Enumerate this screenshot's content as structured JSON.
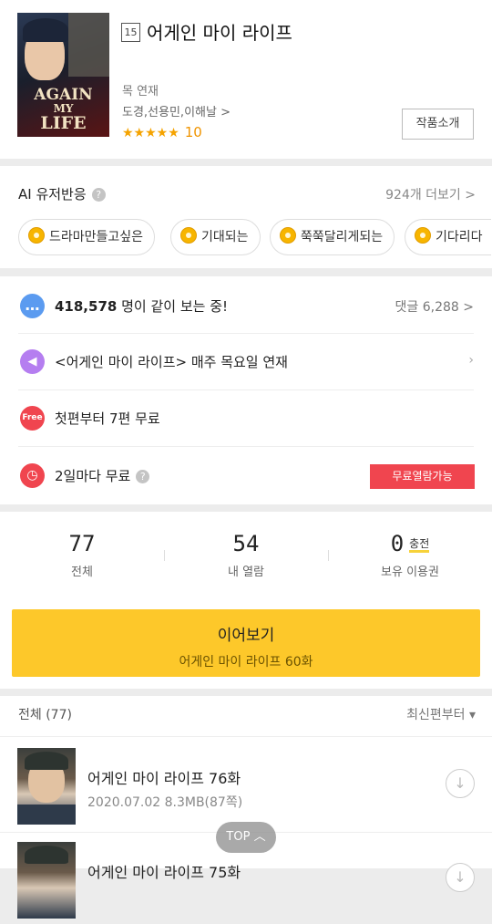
{
  "header": {
    "age_rating": "15",
    "title": "어게인 마이 라이프",
    "schedule": "목 연재",
    "authors": "도경,선용민,이해날 >",
    "stars": "★★★★★",
    "rating": "10",
    "intro_button": "작품소개",
    "cover_text_1": "AGAIN",
    "cover_text_2": "MY",
    "cover_text_3": "LIFE"
  },
  "ai": {
    "title": "AI 유저반응",
    "more": "924개 더보기 >",
    "chips": [
      "드라마만들고싶은",
      "기대되는",
      "쭉쭉달리게되는",
      "기다리다"
    ]
  },
  "info": {
    "viewers_count": "418,578",
    "viewers_suffix": " 명이 같이 보는 중!",
    "comments": "댓글 6,288 >",
    "schedule_text": "<어게인 마이 라이프> 매주 목요일 연재",
    "free_text": "첫편부터 7편 무료",
    "free_badge": "Free",
    "wait_text": "2일마다 무료",
    "wait_button": "무료열람가능"
  },
  "stats": {
    "total": "77",
    "total_label": "전체",
    "read": "54",
    "read_label": "내 열람",
    "owned": "0",
    "charge": "충전",
    "owned_label": "보유 이용권"
  },
  "continue": {
    "label": "이어보기",
    "episode": "어게인 마이 라이프 60화"
  },
  "list": {
    "header": "전체 (77)",
    "sort": "최신편부터 ▾",
    "episodes": [
      {
        "title": "어게인 마이 라이프 76화",
        "meta": "2020.07.02  8.3MB(87쪽)"
      },
      {
        "title": "어게인 마이 라이프 75화",
        "meta": ""
      }
    ]
  },
  "top_button": "TOP ︿",
  "colors": {
    "accent_yellow": "#fdc82a",
    "free_red": "#f0454f",
    "star_orange": "#f5a300"
  }
}
